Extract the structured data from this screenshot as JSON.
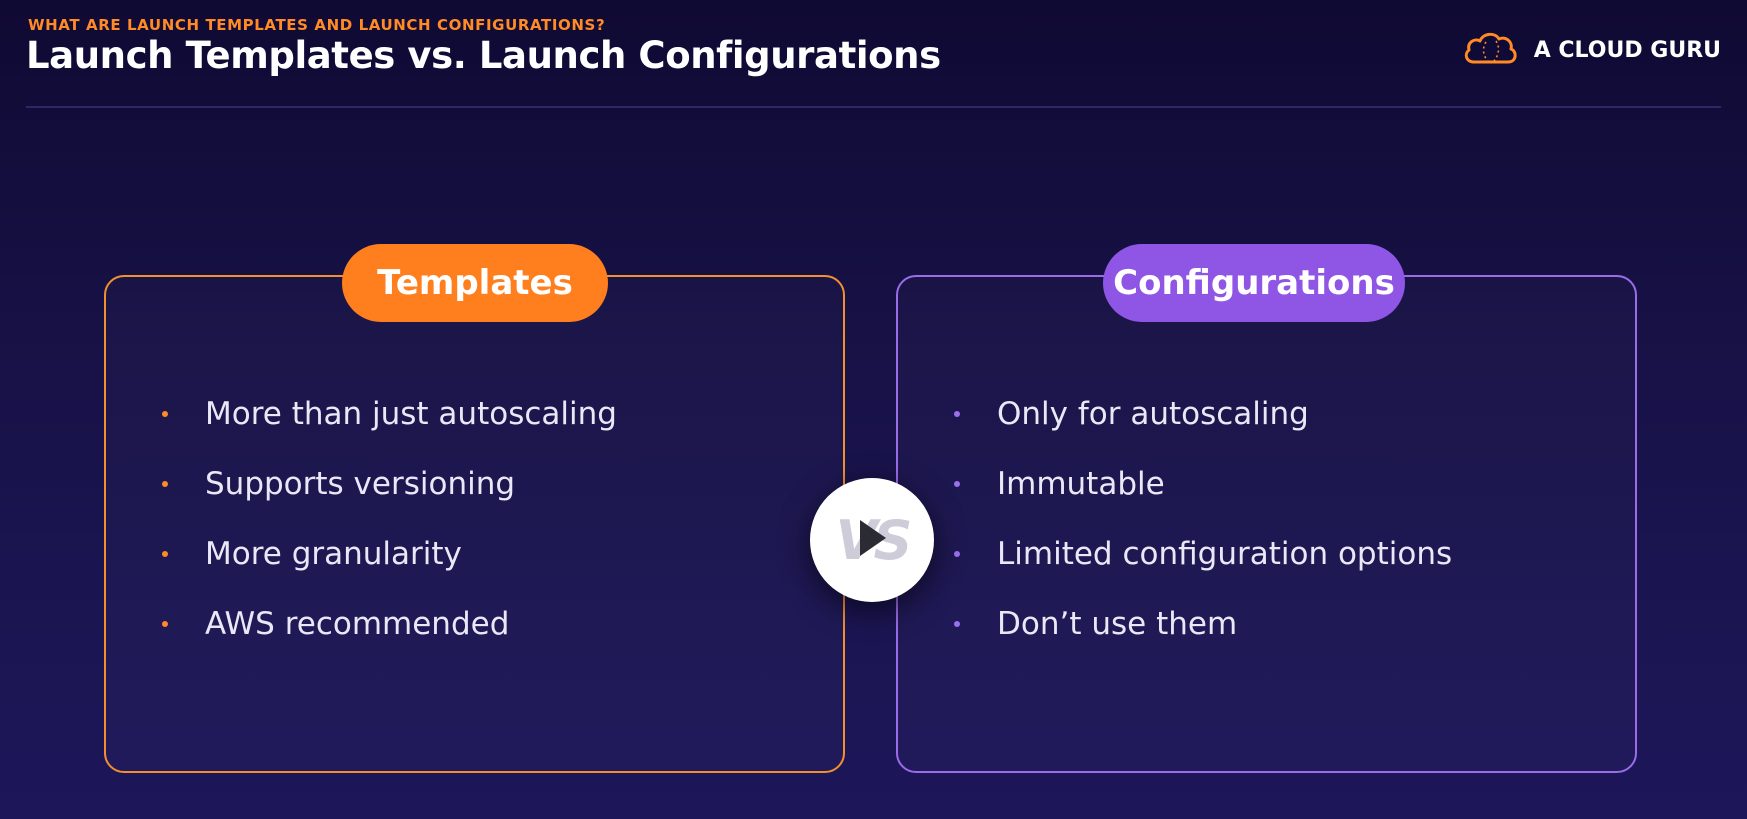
{
  "header": {
    "kicker": "WHAT ARE LAUNCH TEMPLATES AND LAUNCH CONFIGURATIONS?",
    "title": "Launch Templates vs. Launch Configurations"
  },
  "brand": {
    "name": "A CLOUD GURU",
    "icon": "cloud-logo-icon",
    "accent": "#ff8a26"
  },
  "left_panel": {
    "label": "Templates",
    "color": "#ff7f1f",
    "items": [
      "More than just autoscaling",
      "Supports versioning",
      "More granularity",
      "AWS recommended"
    ]
  },
  "right_panel": {
    "label": "Configurations",
    "color": "#8f56e6",
    "items": [
      "Only for autoscaling",
      "Immutable",
      "Limited configuration options",
      "Don’t use them"
    ]
  },
  "vs_badge": {
    "text": "VS",
    "icon": "play-icon"
  }
}
